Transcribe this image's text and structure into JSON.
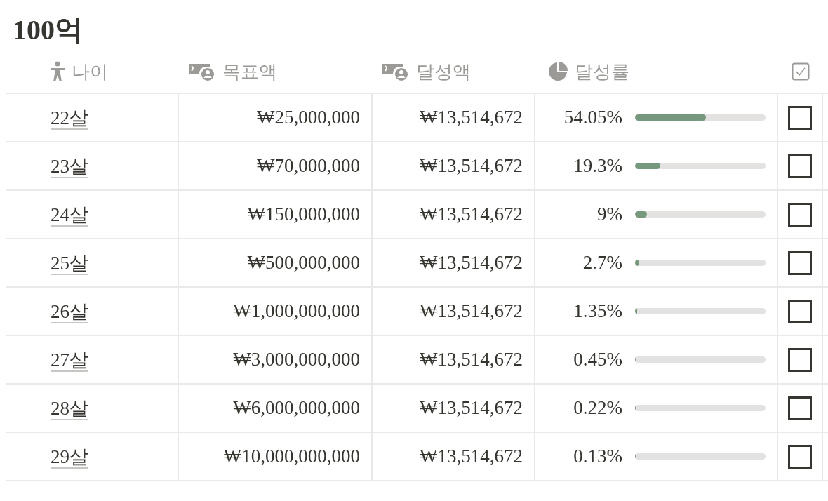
{
  "title": "100억",
  "columns": [
    {
      "label": "나이",
      "kind": "person"
    },
    {
      "label": "목표액",
      "kind": "money"
    },
    {
      "label": "달성액",
      "kind": "money"
    },
    {
      "label": "달성률",
      "kind": "pie"
    },
    {
      "kind": "check"
    }
  ],
  "rows": [
    {
      "age": "22살",
      "target": "₩25,000,000",
      "achieved": "₩13,514,672",
      "rate": "54.05%",
      "level": 0.5405,
      "checked": false
    },
    {
      "age": "23살",
      "target": "₩70,000,000",
      "achieved": "₩13,514,672",
      "rate": "19.3%",
      "level": 0.193,
      "checked": false
    },
    {
      "age": "24살",
      "target": "₩150,000,000",
      "achieved": "₩13,514,672",
      "rate": "9%",
      "level": 0.09,
      "checked": false
    },
    {
      "age": "25살",
      "target": "₩500,000,000",
      "achieved": "₩13,514,672",
      "rate": "2.7%",
      "level": 0.027,
      "checked": false
    },
    {
      "age": "26살",
      "target": "₩1,000,000,000",
      "achieved": "₩13,514,672",
      "rate": "1.35%",
      "level": 0.0135,
      "checked": false
    },
    {
      "age": "27살",
      "target": "₩3,000,000,000",
      "achieved": "₩13,514,672",
      "rate": "0.45%",
      "level": 0.0045,
      "checked": false
    },
    {
      "age": "28살",
      "target": "₩6,000,000,000",
      "achieved": "₩13,514,672",
      "rate": "0.22%",
      "level": 0.0022,
      "checked": false
    },
    {
      "age": "29살",
      "target": "₩10,000,000,000",
      "achieved": "₩13,514,672",
      "rate": "0.13%",
      "level": 0.0013,
      "checked": false
    }
  ]
}
